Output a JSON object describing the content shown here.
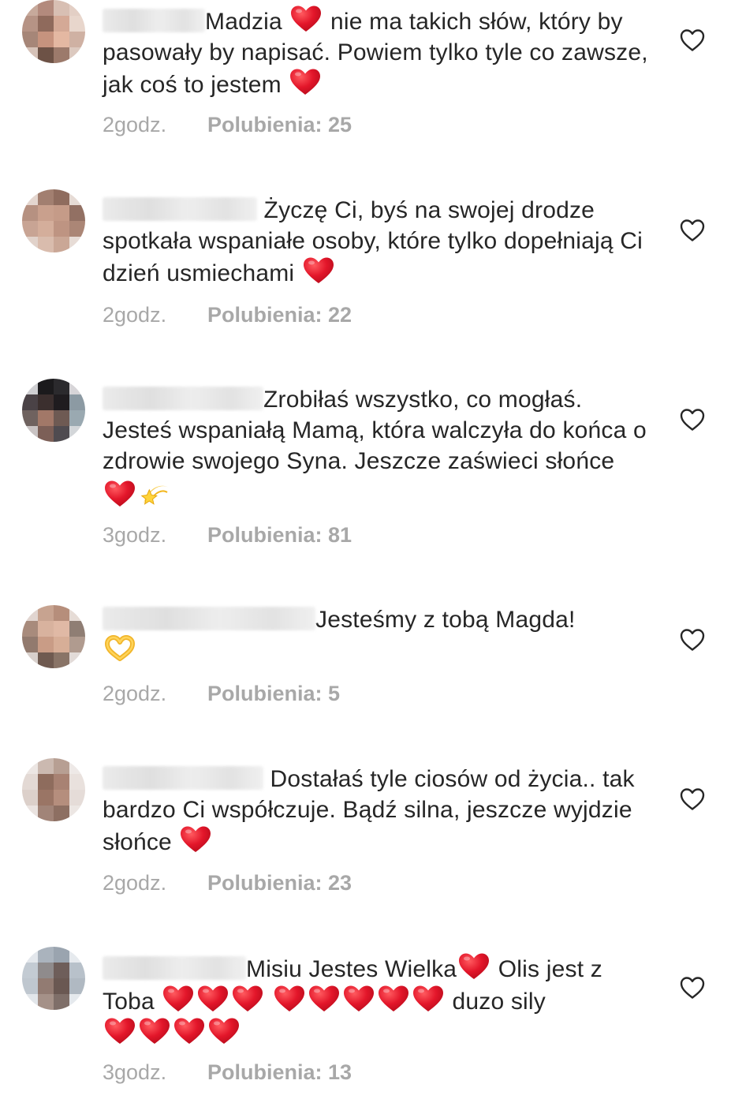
{
  "comments": [
    {
      "text_parts": [
        "Madzia ",
        " nie ma takich słów, który by pasowały by napisać. Powiem tylko tyle co zawsze, jak coś to jestem "
      ],
      "time": "2godz.",
      "likes": "Polubienia: 25"
    },
    {
      "text_parts": [
        "Życzę Ci, byś na swojej drodze spotkała wspaniałe osoby, które tylko dopełniają Ci dzień usmiechami "
      ],
      "time": "2godz.",
      "likes": "Polubienia: 22"
    },
    {
      "text_parts": [
        "Zrobiłaś wszystko, co mogłaś. Jesteś wspaniałą Mamą, która walczyła do końca o zdrowie swojego Syna. Jeszcze zaświeci słońce "
      ],
      "time": "3godz.",
      "likes": "Polubienia: 81"
    },
    {
      "text_parts": [
        "Jesteśmy z tobą Magda!"
      ],
      "time": "2godz.",
      "likes": "Polubienia: 5"
    },
    {
      "text_parts": [
        "Dostałaś tyle ciosów od życia.. tak bardzo Ci współczuje. Bądź silna, jeszcze wyjdzie słońce "
      ],
      "time": "2godz.",
      "likes": "Polubienia: 23"
    },
    {
      "text_parts": [
        "Misiu Jestes Wielka",
        " Olis jest z Toba ",
        " duzo sily"
      ],
      "time": "3godz.",
      "likes": "Polubienia: 13"
    }
  ],
  "icons": {
    "like": "heart-outline-icon",
    "heart_emoji": "red-heart-emoji",
    "dizzy_emoji": "dizzy-star-emoji",
    "heart_hands_emoji": "heart-hands-emoji"
  },
  "colors": {
    "text": "#262626",
    "meta": "#a8a8a8",
    "heart": "#e0162b"
  }
}
